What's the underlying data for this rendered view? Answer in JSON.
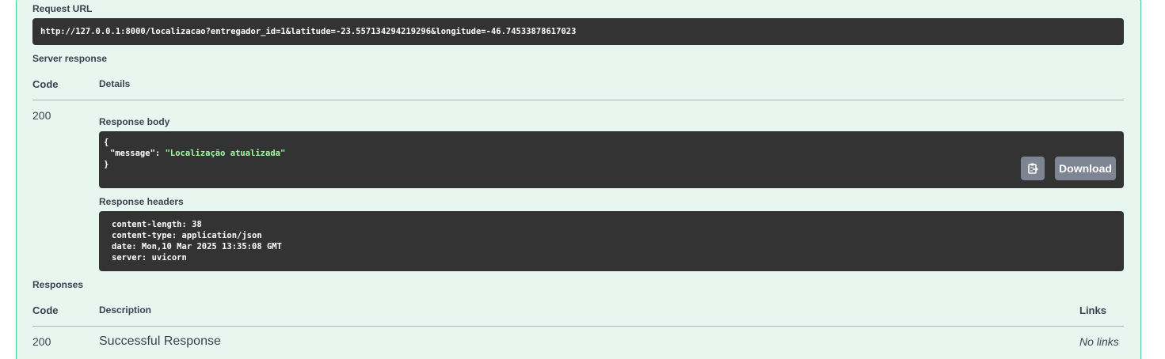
{
  "request_url": {
    "label": "Request URL",
    "value": "http://127.0.0.1:8000/localizacao?entregador_id=1&latitude=-23.557134294219296&longitude=-46.74533878617023"
  },
  "server_response": {
    "label": "Server response",
    "col_code": "Code",
    "col_details": "Details",
    "code": "200",
    "body_label": "Response body",
    "body": {
      "open": "{",
      "key": "\"message\"",
      "colon": ": ",
      "value": "\"Localização atualizada\"",
      "close": "}"
    },
    "copy_icon": "clipboard-copy-icon",
    "download_label": "Download",
    "headers_label": "Response headers",
    "headers": [
      "content-length: 38",
      "content-type: application/json",
      "date: Mon,10 Mar 2025 13:35:08 GMT",
      "server: uvicorn"
    ]
  },
  "responses": {
    "label": "Responses",
    "col_code": "Code",
    "col_description": "Description",
    "col_links": "Links",
    "rows": [
      {
        "code": "200",
        "description": "Successful Response",
        "links": "No links"
      }
    ]
  },
  "colors": {
    "panel_bg": "#e8f6f0",
    "panel_border": "#49cc90",
    "code_bg": "#333333",
    "button_bg": "#7d8492",
    "string_color": "#a2fca2"
  }
}
